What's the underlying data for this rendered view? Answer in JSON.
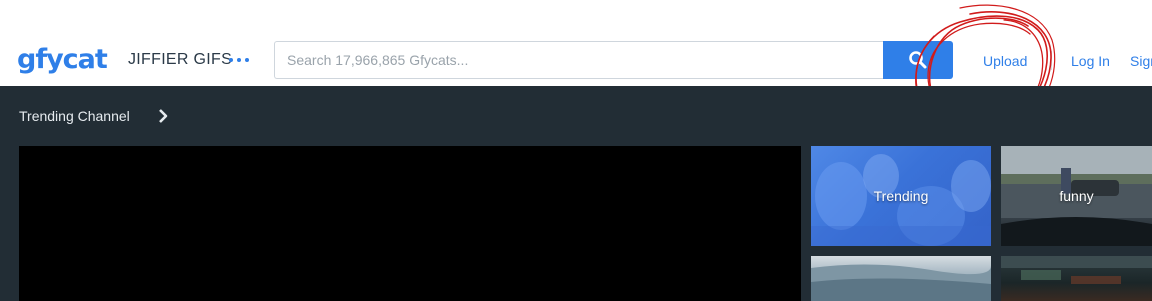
{
  "header": {
    "logo_text": "gfycat",
    "tagline": "JIFFIER GIFS",
    "search_placeholder": "Search 17,966,865 Gfycats...",
    "nav": {
      "upload": "Upload",
      "login": "Log In",
      "signup": "Sign"
    }
  },
  "channel": {
    "title": "Trending Channel"
  },
  "tiles": [
    {
      "label": "Trending"
    },
    {
      "label": "funny"
    }
  ],
  "colors": {
    "brand_blue": "#2f7fe8",
    "dark_band": "#222d35",
    "annotation_red": "#d11b1b"
  }
}
